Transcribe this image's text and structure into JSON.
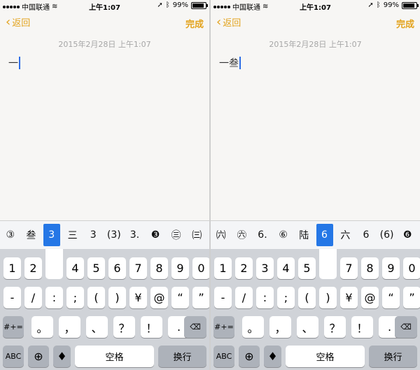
{
  "status": {
    "carrier": "中国联通",
    "time": "上午1:07",
    "battery": "99%"
  },
  "nav": {
    "back": "返回",
    "done": "完成"
  },
  "date": "2015年2月28日 上午1:07",
  "left_panel": {
    "note_text": "一",
    "candidates": [
      "③",
      "叁",
      "3",
      "三",
      "3",
      "(3)",
      "3.",
      "❸",
      "㊂",
      "㈢"
    ],
    "selected_index": 2
  },
  "right_panel": {
    "note_text": "一叁",
    "candidates": [
      "㈥",
      "㊅",
      "6.",
      "⑥",
      "陆",
      "6",
      "六",
      "6",
      "(6)",
      "❻"
    ],
    "selected_index": 5
  },
  "keyboard": {
    "row1": [
      "1",
      "2",
      "3",
      "4",
      "5",
      "6",
      "7",
      "8",
      "9",
      "0"
    ],
    "row2": [
      "-",
      "/",
      ":",
      ";",
      "(",
      ")",
      "¥",
      "@",
      "“",
      "”"
    ],
    "row3": [
      "#+=",
      "。",
      "，",
      "、",
      "？",
      "！",
      ".",
      "⌫"
    ],
    "abc": "ABC",
    "space": "空格",
    "return": "换行"
  }
}
